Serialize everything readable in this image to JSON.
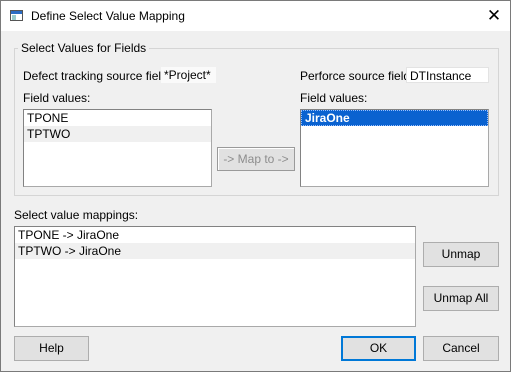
{
  "window": {
    "title": "Define Select Value Mapping"
  },
  "group": {
    "title": "Select Values for Fields"
  },
  "defect": {
    "source_label": "Defect tracking source field:",
    "source_value": "*Project*",
    "values_label": "Field values:",
    "items": [
      "TPONE",
      "TPTWO"
    ]
  },
  "perforce": {
    "source_label": "Perforce source field:",
    "source_value": "DTInstance",
    "values_label": "Field values:",
    "items": [
      "JiraOne"
    ]
  },
  "map_button": "-> Map to ->",
  "mappings": {
    "label": "Select value mappings:",
    "items": [
      "TPONE -> JiraOne",
      "TPTWO -> JiraOne"
    ]
  },
  "buttons": {
    "unmap": "Unmap",
    "unmap_all": "Unmap All",
    "help": "Help",
    "ok": "OK",
    "cancel": "Cancel"
  },
  "icons": {
    "app": "window-icon",
    "close": "close-icon"
  },
  "colors": {
    "selection": "#0a62d0",
    "title_bg": "#ffffff",
    "dialog_bg": "#f0f0f0"
  }
}
